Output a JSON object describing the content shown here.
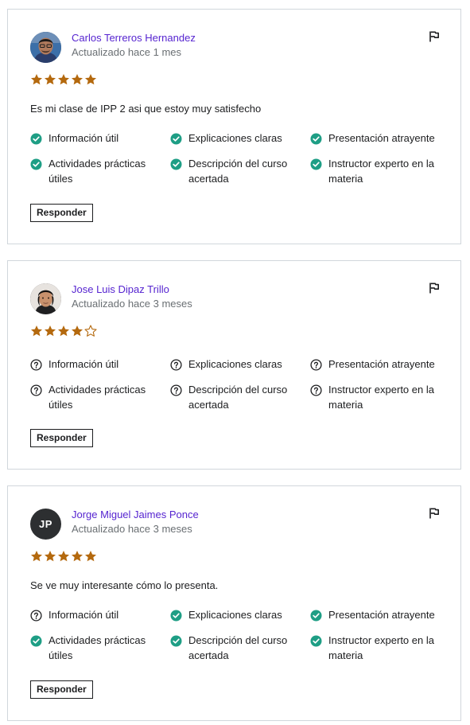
{
  "colors": {
    "name": "#5624d0",
    "star": "#b4690e",
    "check": "#1e9e85",
    "question": "#1c1d1f",
    "border": "#d1d7dc"
  },
  "features": [
    "Información útil",
    "Explicaciones claras",
    "Presentación atrayente",
    "Actividades prácticas útiles",
    "Descripción del curso acertada",
    "Instructor experto en la materia"
  ],
  "reviews": [
    {
      "name": "Carlos Terreros Hernandez",
      "updated": "Actualizado hace 1 mes",
      "rating": 5,
      "comment": "Es mi clase de IPP 2 asi que estoy muy satisfecho",
      "feature_states": [
        "check",
        "check",
        "check",
        "check",
        "check",
        "check"
      ],
      "reply_label": "Responder",
      "avatar": "photo"
    },
    {
      "name": "Jose Luis Dipaz Trillo",
      "updated": "Actualizado hace 3 meses",
      "rating": 4,
      "comment": "",
      "feature_states": [
        "question",
        "question",
        "question",
        "question",
        "question",
        "question"
      ],
      "reply_label": "Responder",
      "avatar": "photo"
    },
    {
      "name": "Jorge Miguel Jaimes Ponce",
      "updated": "Actualizado hace 3 meses",
      "rating": 5,
      "comment": "Se ve muy interesante cómo lo presenta.",
      "feature_states": [
        "question",
        "check",
        "check",
        "check",
        "check",
        "check"
      ],
      "reply_label": "Responder",
      "avatar": "initials",
      "initials": "JP"
    }
  ]
}
